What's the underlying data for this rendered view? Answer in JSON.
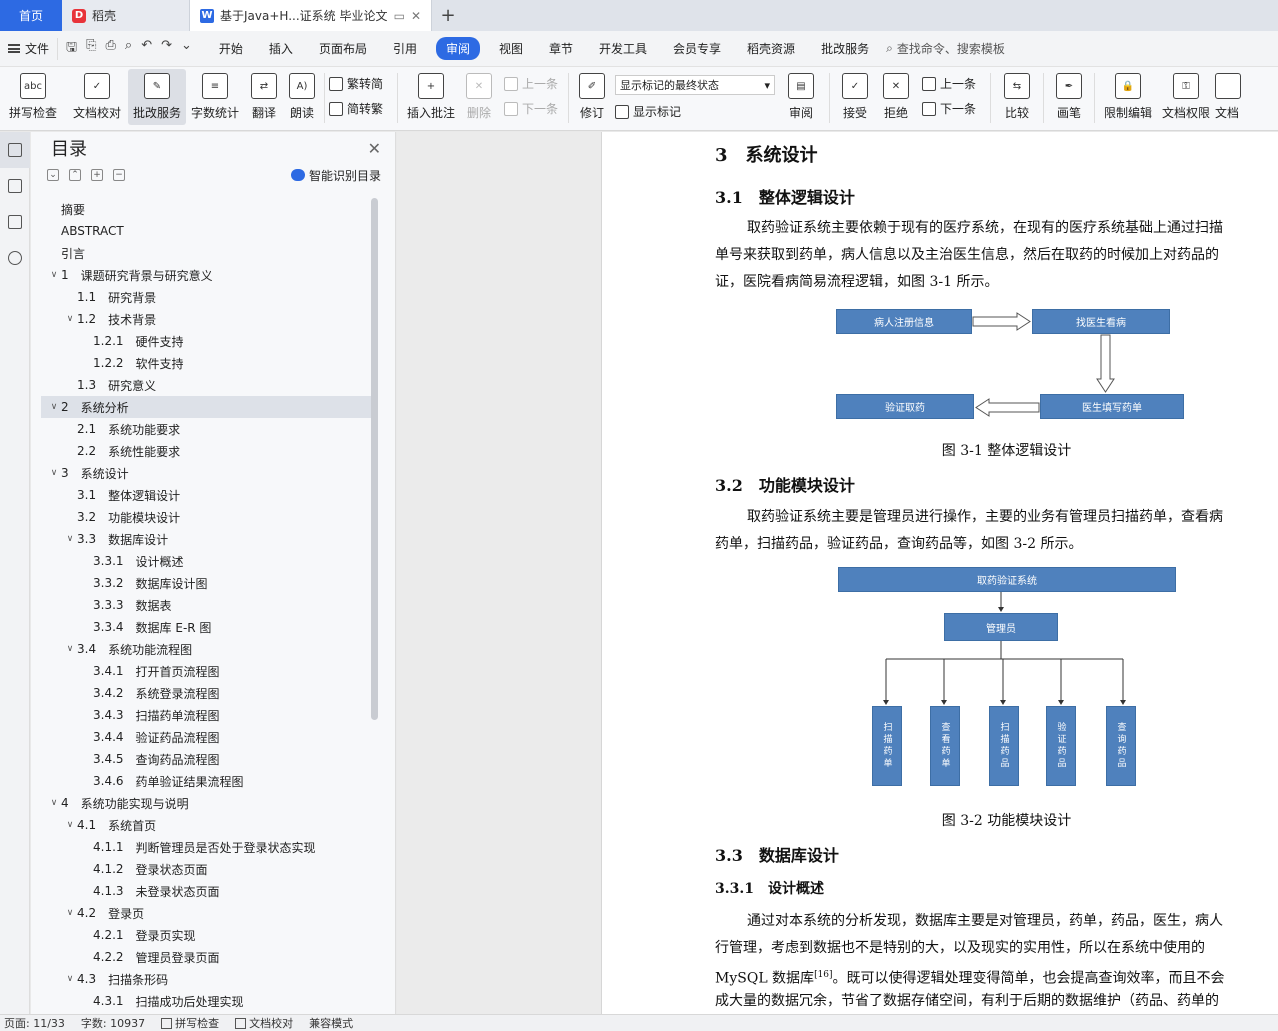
{
  "tabs": {
    "home": "首页",
    "daoke": "稻壳",
    "doc_title": "基于Java+H...证系统 毕业论文",
    "new_tab": "+"
  },
  "menubar": {
    "file": "文件",
    "items": [
      "开始",
      "插入",
      "页面布局",
      "引用",
      "审阅",
      "视图",
      "章节",
      "开发工具",
      "会员专享",
      "稻壳资源",
      "批改服务"
    ],
    "active": "审阅",
    "search": "查找命令、搜索模板"
  },
  "ribbon": {
    "spell": "拼写检查",
    "doccheck": "文档校对",
    "revise_service": "批改服务",
    "wordcount": "字数统计",
    "translate": "翻译",
    "read": "朗读",
    "trad2simp": "繁转简",
    "simp2trad": "简转繁",
    "insert_comment": "插入批注",
    "delete": "删除",
    "prev": "上一条",
    "next": "下一条",
    "revise": "修订",
    "show_mode": "显示标记的最终状态",
    "show_marks": "显示标记",
    "review": "审阅",
    "accept": "接受",
    "reject": "拒绝",
    "prev2": "上一条",
    "next2": "下一条",
    "compare": "比较",
    "pen": "画笔",
    "restrict": "限制编辑",
    "rights": "文档权限",
    "docx": "文档"
  },
  "toc": {
    "title": "目录",
    "smart": "智能识别目录",
    "items": [
      {
        "level": 0,
        "num": "",
        "text": "摘要",
        "arrow": false
      },
      {
        "level": 0,
        "num": "",
        "text": "ABSTRACT",
        "arrow": false
      },
      {
        "level": 0,
        "num": "",
        "text": "引言",
        "arrow": false
      },
      {
        "level": 0,
        "num": "1",
        "text": "课题研究背景与研究意义",
        "arrow": true
      },
      {
        "level": 1,
        "num": "1.1",
        "text": "研究背景",
        "arrow": false
      },
      {
        "level": 1,
        "num": "1.2",
        "text": "技术背景",
        "arrow": true
      },
      {
        "level": 2,
        "num": "1.2.1",
        "text": "硬件支持",
        "arrow": false
      },
      {
        "level": 2,
        "num": "1.2.2",
        "text": "软件支持",
        "arrow": false
      },
      {
        "level": 1,
        "num": "1.3",
        "text": "研究意义",
        "arrow": false
      },
      {
        "level": 0,
        "num": "2",
        "text": "系统分析",
        "arrow": true,
        "selected": true
      },
      {
        "level": 1,
        "num": "2.1",
        "text": "系统功能要求",
        "arrow": false
      },
      {
        "level": 1,
        "num": "2.2",
        "text": "系统性能要求",
        "arrow": false
      },
      {
        "level": 0,
        "num": "3",
        "text": "系统设计",
        "arrow": true
      },
      {
        "level": 1,
        "num": "3.1",
        "text": "整体逻辑设计",
        "arrow": false
      },
      {
        "level": 1,
        "num": "3.2",
        "text": "功能模块设计",
        "arrow": false
      },
      {
        "level": 1,
        "num": "3.3",
        "text": "数据库设计",
        "arrow": true
      },
      {
        "level": 2,
        "num": "3.3.1",
        "text": "设计概述",
        "arrow": false
      },
      {
        "level": 2,
        "num": "3.3.2",
        "text": "数据库设计图",
        "arrow": false
      },
      {
        "level": 2,
        "num": "3.3.3",
        "text": "数据表",
        "arrow": false
      },
      {
        "level": 2,
        "num": "3.3.4",
        "text": "数据库 E-R 图",
        "arrow": false
      },
      {
        "level": 1,
        "num": "3.4",
        "text": "系统功能流程图",
        "arrow": true
      },
      {
        "level": 2,
        "num": "3.4.1",
        "text": "打开首页流程图",
        "arrow": false
      },
      {
        "level": 2,
        "num": "3.4.2",
        "text": "系统登录流程图",
        "arrow": false
      },
      {
        "level": 2,
        "num": "3.4.3",
        "text": "扫描药单流程图",
        "arrow": false
      },
      {
        "level": 2,
        "num": "3.4.4",
        "text": "验证药品流程图",
        "arrow": false
      },
      {
        "level": 2,
        "num": "3.4.5",
        "text": "查询药品流程图",
        "arrow": false
      },
      {
        "level": 2,
        "num": "3.4.6",
        "text": "药单验证结果流程图",
        "arrow": false
      },
      {
        "level": 0,
        "num": "4",
        "text": "系统功能实现与说明",
        "arrow": true
      },
      {
        "level": 1,
        "num": "4.1",
        "text": "系统首页",
        "arrow": true
      },
      {
        "level": 2,
        "num": "4.1.1",
        "text": "判断管理员是否处于登录状态实现",
        "arrow": false
      },
      {
        "level": 2,
        "num": "4.1.2",
        "text": "登录状态页面",
        "arrow": false
      },
      {
        "level": 2,
        "num": "4.1.3",
        "text": "未登录状态页面",
        "arrow": false
      },
      {
        "level": 1,
        "num": "4.2",
        "text": "登录页",
        "arrow": true
      },
      {
        "level": 2,
        "num": "4.2.1",
        "text": "登录页实现",
        "arrow": false
      },
      {
        "level": 2,
        "num": "4.2.2",
        "text": "管理员登录页面",
        "arrow": false
      },
      {
        "level": 1,
        "num": "4.3",
        "text": "扫描条形码",
        "arrow": true
      },
      {
        "level": 2,
        "num": "4.3.1",
        "text": "扫描成功后处理实现",
        "arrow": false
      }
    ]
  },
  "doc": {
    "h_3": "3　系统设计",
    "h_31": "3.1　整体逻辑设计",
    "p_31_1": "取药验证系统主要依赖于现有的医疗系统，在现有的医疗系统基础上通过扫描",
    "p_31_2": "单号来获取到药单，病人信息以及主治医生信息，然后在取药的时候加上对药品的",
    "p_31_3": "证，医院看病简易流程逻辑，如图 3-1 所示。",
    "fig1": {
      "register": "病人注册信息",
      "doctor": "找医生看病",
      "prescribe": "医生填写药单",
      "verify": "验证取药"
    },
    "cap1": "图 3-1  整体逻辑设计",
    "h_32": "3.2　功能模块设计",
    "p_32_1": "取药验证系统主要是管理员进行操作，主要的业务有管理员扫描药单，查看病",
    "p_32_2": "药单，扫描药品，验证药品，查询药品等，如图 3-2 所示。",
    "fig2": {
      "root": "取药验证系统",
      "admin": "管理员",
      "leaves": [
        "扫描药单",
        "查看药单",
        "扫描药品",
        "验证药品",
        "查询药品"
      ]
    },
    "cap2": "图 3-2  功能模块设计",
    "h_33": "3.3　数据库设计",
    "h_331": "3.3.1　设计概述",
    "p_331_1": "通过对本系统的分析发现，数据库主要是对管理员，药单，药品，医生，病人",
    "p_331_2": "行管理，考虑到数据也不是特别的大，以及现实的实用性，所以在系统中使用的",
    "p_331_3a": "MySQL 数据库",
    "p_331_3sup": "[16]",
    "p_331_3b": "。既可以使得逻辑处理变得简单，也会提高查询效率，而且不会",
    "p_331_4": "成大量的数据冗余，节省了数据存储空间，有利于后期的数据维护（药品、药单的"
  },
  "status": {
    "page": "页面: 11/33",
    "words": "字数: 10937",
    "spell": "拼写检查",
    "check": "文档校对",
    "compat": "兼容模式"
  },
  "colors": {
    "accent": "#2d6ae3",
    "box_fill": "#4f81bd"
  }
}
